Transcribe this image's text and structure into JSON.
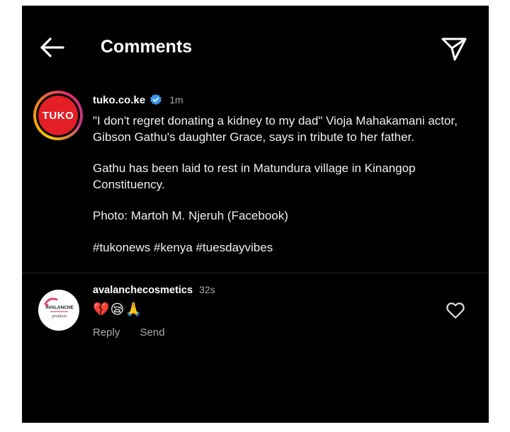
{
  "header": {
    "back_icon": "arrow-left-icon",
    "title": "Comments",
    "send_icon": "paper-plane-icon"
  },
  "caption": {
    "avatar_text": "TUKO",
    "username": "tuko.co.ke",
    "verified_icon": "verified-badge-icon",
    "time": "1m",
    "paragraphs": [
      "\"I don't regret donating a kidney to my dad\" Vioja Mahakamani actor, Gibson Gathu's daughter Grace, says in tribute to her father.",
      "Gathu has been laid to rest in Matundura village in Kinangop Constituency.",
      "Photo: Martoh M. Njeruh (Facebook)",
      "#tukonews #kenya #tuesdayvibes"
    ]
  },
  "comments": [
    {
      "avatar_text": "AVALANCHE",
      "avatar_subtext": "products",
      "username": "avalanchecosmetics",
      "time": "32s",
      "text": "💔😪🙏",
      "reply_label": "Reply",
      "send_label": "Send",
      "like_icon": "heart-outline-icon"
    }
  ],
  "colors": {
    "background": "#000000",
    "text_primary": "#ffffff",
    "text_secondary": "#a8a8a8",
    "brand_red": "#e41e26",
    "verified_blue": "#3897f0"
  }
}
